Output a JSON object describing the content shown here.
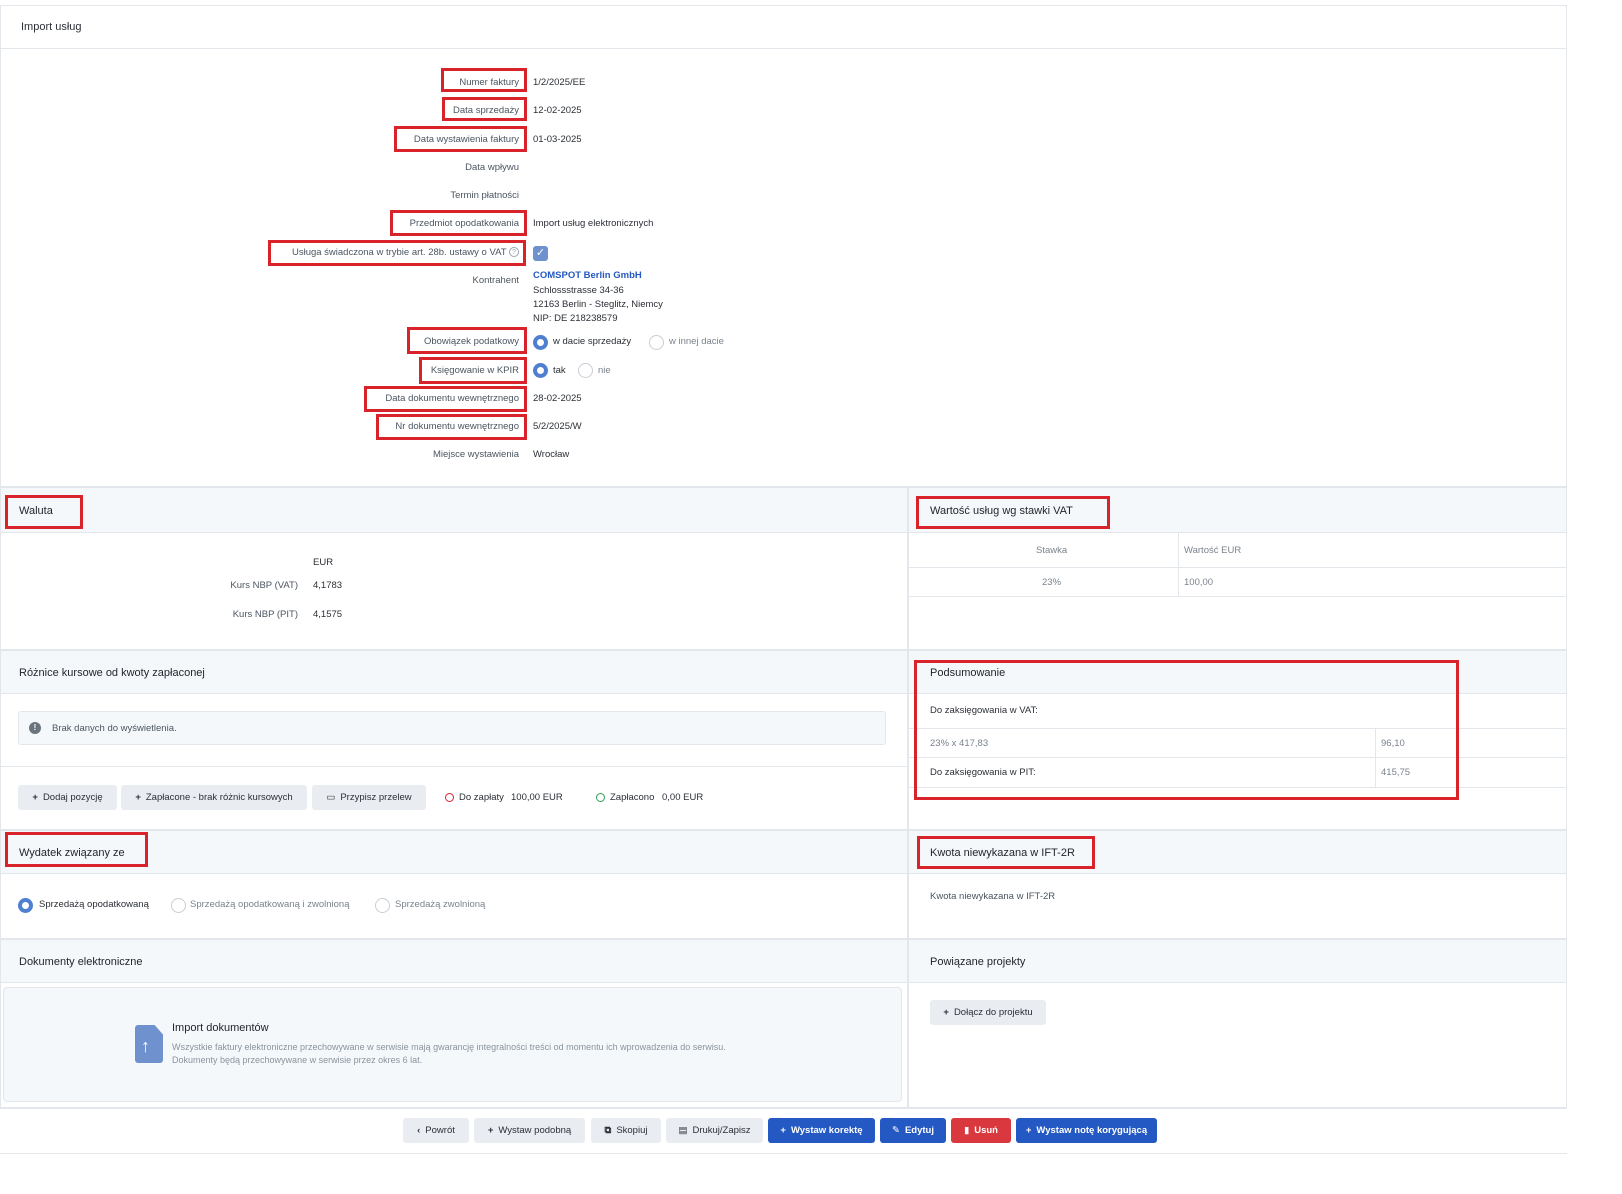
{
  "header": {
    "title": "Import usług"
  },
  "details": {
    "numer_faktury": {
      "label": "Numer faktury",
      "value": "1/2/2025/EE"
    },
    "data_sprzedazy": {
      "label": "Data sprzedaży",
      "value": "12-02-2025"
    },
    "data_wystawienia": {
      "label": "Data wystawienia faktury",
      "value": "01-03-2025"
    },
    "data_wplywu": {
      "label": "Data wpływu",
      "value": ""
    },
    "termin_platnosci": {
      "label": "Termin płatności",
      "value": ""
    },
    "przedmiot": {
      "label": "Przedmiot opodatkowania",
      "value": "Import usług elektronicznych"
    },
    "usluga_28b": {
      "label": "Usługa świadczona w trybie art. 28b. ustawy o VAT",
      "checked": true
    },
    "kontrahent": {
      "label": "Kontrahent",
      "name": "COMSPOT Berlin GmbH",
      "street": "Schlossstrasse 34-36",
      "city": "12163 Berlin - Steglitz, Niemcy",
      "nip": "NIP: DE 218238579"
    },
    "obowiazek": {
      "label": "Obowiązek podatkowy",
      "option1": "w dacie sprzedaży",
      "option2": "w innej dacie",
      "selected": 1
    },
    "kpir": {
      "label": "Księgowanie w KPIR",
      "option1": "tak",
      "option2": "nie",
      "selected": 1
    },
    "data_dok_wewn": {
      "label": "Data dokumentu wewnętrznego",
      "value": "28-02-2025"
    },
    "nr_dok_wewn": {
      "label": "Nr dokumentu wewnętrznego",
      "value": "5/2/2025/W"
    },
    "miejsce": {
      "label": "Miejsce wystawienia",
      "value": "Wrocław"
    }
  },
  "waluta": {
    "title": "Waluta",
    "currency": "EUR",
    "kurs_vat_label": "Kurs NBP (VAT)",
    "kurs_vat": "4,1783",
    "kurs_pit_label": "Kurs NBP (PIT)",
    "kurs_pit": "4,1575"
  },
  "wartosc": {
    "title": "Wartość usług wg stawki VAT",
    "col_stawka": "Stawka",
    "col_wartosc": "Wartość EUR",
    "rows": [
      {
        "stawka": "23%",
        "wartosc": "100,00"
      }
    ]
  },
  "roznice": {
    "title": "Różnice kursowe od kwoty zapłaconej",
    "empty": "Brak danych do wyświetlenia.",
    "btn_dodaj": "Dodaj pozycję",
    "btn_zaplacone": "Zapłacone - brak różnic kursowych",
    "btn_przypisz": "Przypisz przelew",
    "do_zaplaty_label": "Do zapłaty",
    "do_zaplaty": "100,00 EUR",
    "zaplacono_label": "Zapłacono",
    "zaplacono": "0,00 EUR"
  },
  "podsumowanie": {
    "title": "Podsumowanie",
    "vat_label": "Do zaksięgowania w VAT:",
    "vat_calc": "23% x 417,83",
    "vat_value": "96,10",
    "pit_label": "Do zaksięgowania w PIT:",
    "pit_value": "415,75"
  },
  "wydatek": {
    "title": "Wydatek związany ze",
    "opt1": "Sprzedażą opodatkowaną",
    "opt2": "Sprzedażą opodatkowaną i zwolnioną",
    "opt3": "Sprzedażą zwolnioną",
    "selected": 1
  },
  "kwota": {
    "title": "Kwota niewykazana w IFT-2R",
    "label": "Kwota niewykazana w IFT-2R"
  },
  "dokumenty": {
    "title": "Dokumenty elektroniczne",
    "import_title": "Import dokumentów",
    "import_line1": "Wszystkie faktury elektroniczne przechowywane w serwisie mają gwarancję integralności treści od momentu ich wprowadzenia do serwisu.",
    "import_line2": "Dokumenty będą przechowywane w serwisie przez okres 6 lat."
  },
  "projekty": {
    "title": "Powiązane projekty",
    "btn": "Dołącz do projektu"
  },
  "footer": {
    "powrot": "Powrót",
    "podobna": "Wystaw podobną",
    "skopiuj": "Skopiuj",
    "drukuj": "Drukuj/Zapisz",
    "korekta": "Wystaw korektę",
    "edytuj": "Edytuj",
    "usun": "Usuń",
    "nota": "Wystaw notę korygującą"
  },
  "colors": {
    "accent": "#2458c2",
    "highlight": "#d8232a",
    "danger": "#d9393e"
  }
}
